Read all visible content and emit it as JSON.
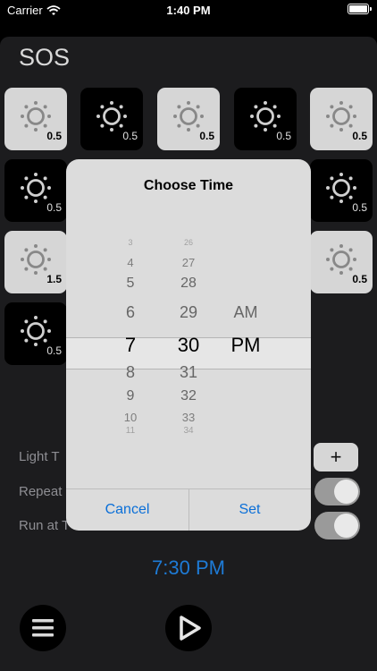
{
  "status_bar": {
    "carrier": "Carrier",
    "time": "1:40 PM"
  },
  "app": {
    "title": "SOS"
  },
  "tiles": [
    {
      "value": "0.5",
      "style": "light"
    },
    {
      "value": "0.5",
      "style": "dark"
    },
    {
      "value": "0.5",
      "style": "light"
    },
    {
      "value": "0.5",
      "style": "dark"
    },
    {
      "value": "0.5",
      "style": "light"
    },
    {
      "value": "0.5",
      "style": "dark"
    },
    {
      "value": "0.5",
      "style": "dark"
    },
    {
      "value": "1.5",
      "style": "light"
    },
    {
      "value": "0.5",
      "style": "light"
    },
    {
      "value": "0.5",
      "style": "dark"
    }
  ],
  "settings": {
    "light_label": "Light T",
    "repeat_label": "Repeat",
    "run_label": "Run at T",
    "plus_label": "+"
  },
  "scheduled_time": "7:30 PM",
  "modal": {
    "title": "Choose Time",
    "hours": [
      "3",
      "4",
      "5",
      "6",
      "7",
      "8",
      "9",
      "10",
      "11"
    ],
    "minutes": [
      "26",
      "27",
      "28",
      "29",
      "30",
      "31",
      "32",
      "33",
      "34"
    ],
    "periods": [
      "AM",
      "PM"
    ],
    "selected_hour": "7",
    "selected_minute": "30",
    "selected_period": "PM",
    "cancel_label": "Cancel",
    "set_label": "Set"
  },
  "colors": {
    "accent": "#1e7bd6",
    "panel": "#1c1c1e",
    "tile_light": "#d6d6d6",
    "tile_dark": "#000000"
  },
  "icons": {
    "tile": "sun-icon",
    "menu": "menu-icon",
    "play": "play-icon",
    "wifi": "wifi-icon"
  }
}
